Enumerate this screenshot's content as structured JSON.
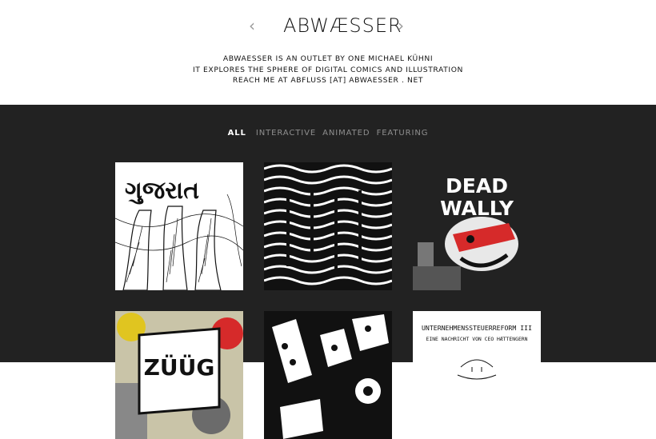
{
  "header": {
    "logo": "ABWÆSSER",
    "prev_arrow": "‹",
    "next_arrow": "›",
    "intro_lines": [
      "ABWAESSER IS AN OUTLET BY ONE MICHAEL KÜHNI",
      "IT EXPLORES THE SPHERE OF DIGITAL COMICS AND ILLUSTRATION",
      "REACH ME AT ABFLUSS [AT] ABWAESSER . NET"
    ]
  },
  "filters": [
    "ALL",
    "INTERACTIVE",
    "ANIMATED",
    "FEATURING"
  ],
  "tiles": {
    "t1": {
      "title": "ગુજરાત"
    },
    "t2": {
      "title": ""
    },
    "t3": {
      "title": "DEAD WALLY",
      "line1": "DEAD",
      "line2": "WALLY"
    },
    "t4": {
      "title": "ZÜÜG",
      "text": "ZÜÜG"
    },
    "t5": {
      "title": ""
    },
    "t6": {
      "line1": "UNTERNEHMENSSTEUERREFORM III",
      "line2": "EINE NACHRICHT VON CEO HÆTTENGERN"
    }
  },
  "colors": {
    "header_bg": "#ffffff",
    "main_bg": "#222222",
    "accent_red": "#d62a2a"
  }
}
